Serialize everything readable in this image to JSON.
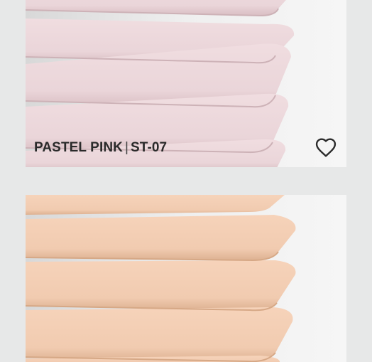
{
  "products": [
    {
      "color_name": "PASTEL PINK",
      "separator": "|",
      "code": "ST-07",
      "swatch_color": "#ecd6da",
      "swatch_shadow": "#d9bfc4",
      "favorite_icon": "heart-outline-icon",
      "favorited": false
    },
    {
      "swatch_color": "#f1cbb0",
      "swatch_shadow": "#ddb191"
    }
  ],
  "colors": {
    "page_background": "#e7e8e8",
    "wall": "#ededed",
    "caption_text": "#2a2a2a"
  }
}
